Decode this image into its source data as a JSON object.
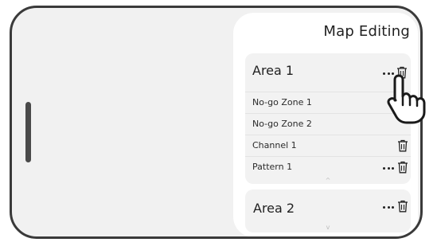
{
  "panel": {
    "title": "Map Editing"
  },
  "areas": [
    {
      "title": "Area 1",
      "items": [
        {
          "label": "No-go Zone 1",
          "has_more": false
        },
        {
          "label": "No-go Zone 2",
          "has_more": false
        },
        {
          "label": "Channel 1",
          "has_more": false
        },
        {
          "label": "Pattern 1",
          "has_more": true
        }
      ],
      "expanded": true
    },
    {
      "title": "Area 2",
      "expanded": false
    }
  ],
  "icons": {
    "more": "more-horizontal-icon",
    "delete": "trash-icon",
    "pointer": "hand-pointer-icon",
    "expand": "chevron-down-icon",
    "collapse": "chevron-up-icon"
  },
  "colors": {
    "panel_bg": "#ffffff",
    "card_bg": "#f2f2f2",
    "device_border": "#3a3a3a",
    "text": "#222222"
  }
}
